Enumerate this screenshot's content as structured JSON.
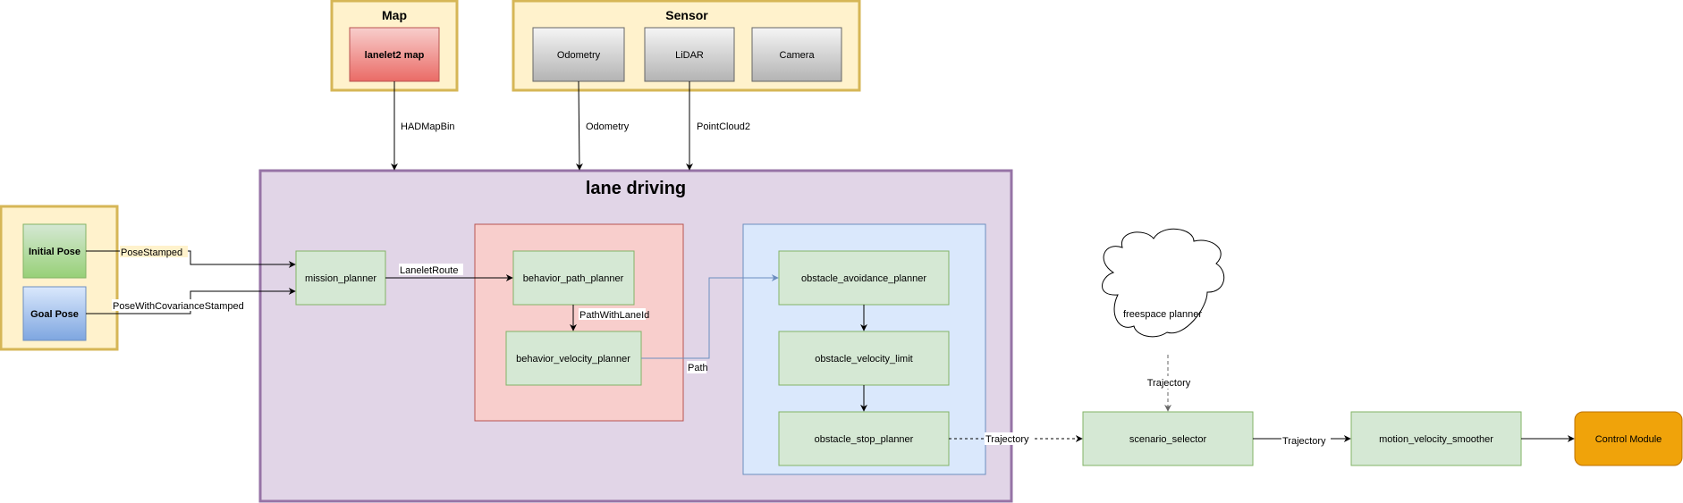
{
  "groups": {
    "map": {
      "title": "Map"
    },
    "sensor": {
      "title": "Sensor"
    },
    "pose_inputs": {
      "title": ""
    },
    "lane_driving": {
      "title": "lane driving"
    }
  },
  "nodes": {
    "lanelet2_map": "lanelet2 map",
    "odometry_sensor": "Odometry",
    "lidar": "LiDAR",
    "camera": "Camera",
    "initial_pose": "Initial Pose",
    "goal_pose": "Goal Pose",
    "mission_planner": "mission_planner",
    "behavior_path_planner": "behavior_path_planner",
    "behavior_velocity_planner": "behavior_velocity_planner",
    "obstacle_avoidance_planner": "obstacle_avoidance_planner",
    "obstacle_velocity_limit": "obstacle_velocity_limit",
    "obstacle_stop_planner": "obstacle_stop_planner",
    "freespace_planner": "freespace planner",
    "scenario_selector": "scenario_selector",
    "motion_velocity_smoother": "motion_velocity_smoother",
    "control_module": "Control Module"
  },
  "edges": {
    "map_to_lane": "HADMapBin",
    "odometry_to_lane": "Odometry",
    "lidar_to_lane": "PointCloud2",
    "initial_to_mission": "PoseStamped",
    "goal_to_mission": "PoseWithCovarianceStamped",
    "mission_to_bpp": "LaneletRoute",
    "bpp_to_bvp": "PathWithLaneId",
    "bvp_to_oap": "Path",
    "osp_to_selector": "Trajectory",
    "freespace_to_selector": "Trajectory",
    "selector_to_smoother": "Trajectory"
  },
  "colors": {
    "group_fill": "#fff2cc",
    "group_stroke": "#d6b656",
    "lane_fill": "#e1d5e7",
    "lane_stroke": "#9673a6",
    "behavior_fill": "#f8cecc",
    "behavior_stroke": "#b85450",
    "obstacle_fill": "#dae8fc",
    "obstacle_stroke": "#6c8ebf",
    "node_fill": "#d5e8d4",
    "node_stroke": "#82b366",
    "control_fill": "#f0a30a",
    "control_stroke": "#bd7000"
  }
}
